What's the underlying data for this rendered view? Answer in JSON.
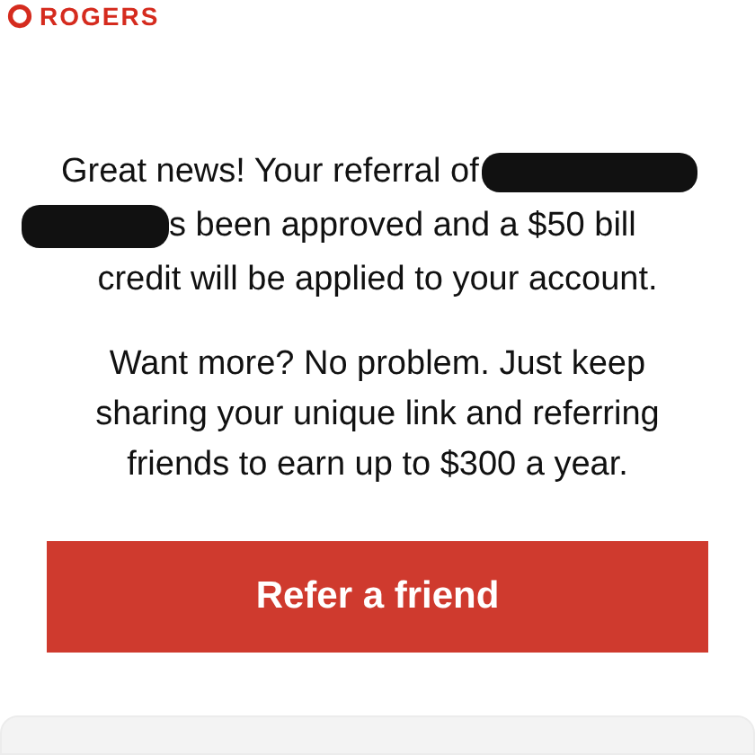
{
  "logo": "ROGERS",
  "message": {
    "text_before_redaction": "Great news! Your referral of",
    "text_after_redaction": "s been approved and a $50 bill",
    "last_line": "credit will be applied to your account."
  },
  "paragraph": "Want more? No problem. Just keep sharing your unique link and referring friends to earn up to $300 a year.",
  "button": "Refer a friend"
}
